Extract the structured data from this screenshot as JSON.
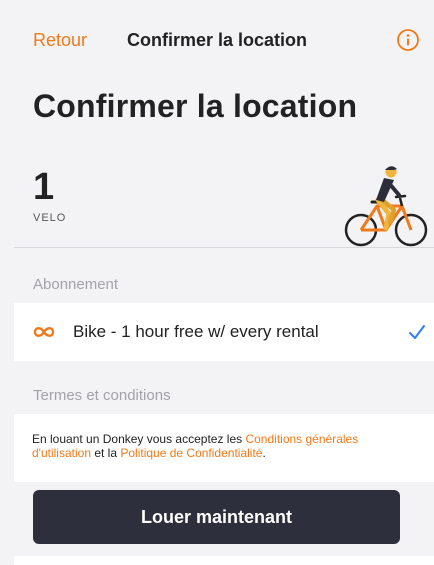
{
  "nav": {
    "back_label": "Retour",
    "title": "Confirmer la location"
  },
  "header": {
    "title": "Confirmer la location"
  },
  "count": {
    "value": "1",
    "label": "VELO"
  },
  "subscription": {
    "section_label": "Abonnement",
    "selected": "Bike - 1 hour free w/ every rental"
  },
  "terms": {
    "section_label": "Termes et conditions",
    "text_1": "En louant un Donkey vous acceptez les ",
    "link_1": "Conditions générales d'utilisation",
    "text_2": " et la ",
    "link_2": "Politique de Confidentialité",
    "text_3": "."
  },
  "cta": {
    "label": "Louer maintenant"
  },
  "colors": {
    "accent": "#f07a1a",
    "primary_button": "#2e2f3c",
    "check": "#2f7cf6"
  },
  "icons": [
    "info-icon",
    "bicycle-illustration",
    "infinity-icon",
    "checkmark-icon"
  ]
}
